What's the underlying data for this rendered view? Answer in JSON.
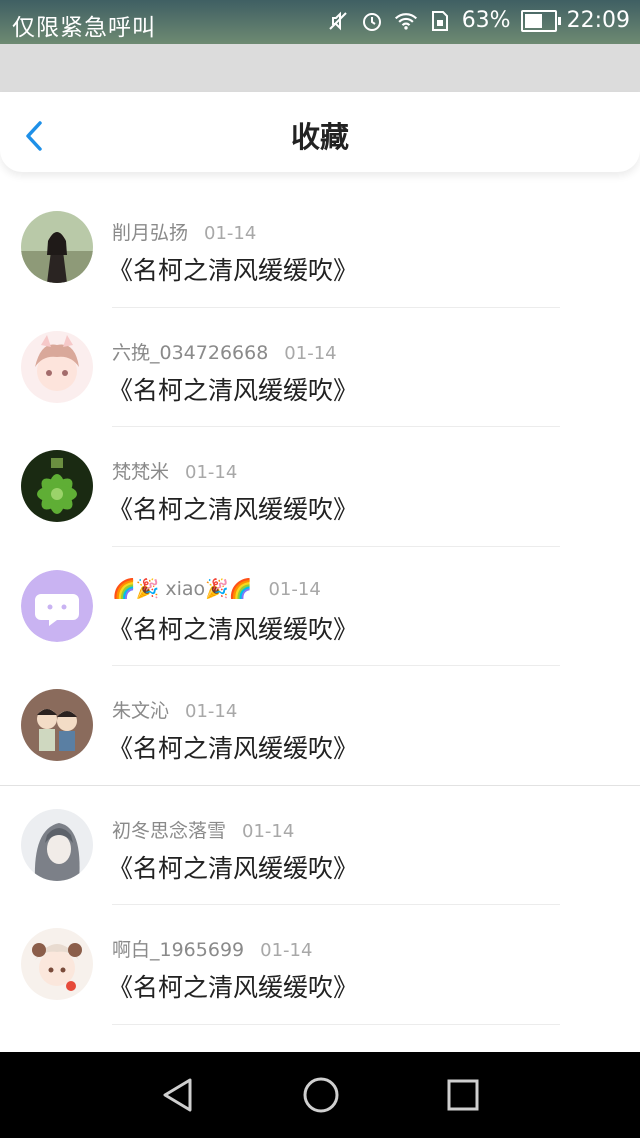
{
  "status_bar": {
    "left_text": "仅限紧急呼叫",
    "battery": "63%",
    "battery_level": 0.63,
    "time": "22:09",
    "icons": [
      "mute-icon",
      "alarm-icon",
      "wifi-icon",
      "sim-icon",
      "battery-icon"
    ]
  },
  "header": {
    "title": "收藏",
    "back_icon": "chevron-left-icon"
  },
  "list": [
    {
      "user": "削月弘扬",
      "date": "01-14",
      "book": "《名柯之清风缓缓吹》"
    },
    {
      "user": "六挽_034726668",
      "date": "01-14",
      "book": "《名柯之清风缓缓吹》"
    },
    {
      "user": "梵梵米",
      "date": "01-14",
      "book": "《名柯之清风缓缓吹》"
    },
    {
      "user": "🌈🎉 xiao🎉🌈",
      "date": "01-14",
      "book": "《名柯之清风缓缓吹》"
    },
    {
      "user": "朱文沁",
      "date": "01-14",
      "book": "《名柯之清风缓缓吹》"
    },
    {
      "user": "初冬思念落雪",
      "date": "01-14",
      "book": "《名柯之清风缓缓吹》"
    },
    {
      "user": "啊白_1965699",
      "date": "01-14",
      "book": "《名柯之清风缓缓吹》"
    }
  ],
  "colors": {
    "accent": "#1e90e8",
    "status_bar": "#4b6a6a",
    "nav_bar": "#000000"
  },
  "system_nav": [
    "back-triangle-icon",
    "home-circle-icon",
    "recents-square-icon"
  ]
}
